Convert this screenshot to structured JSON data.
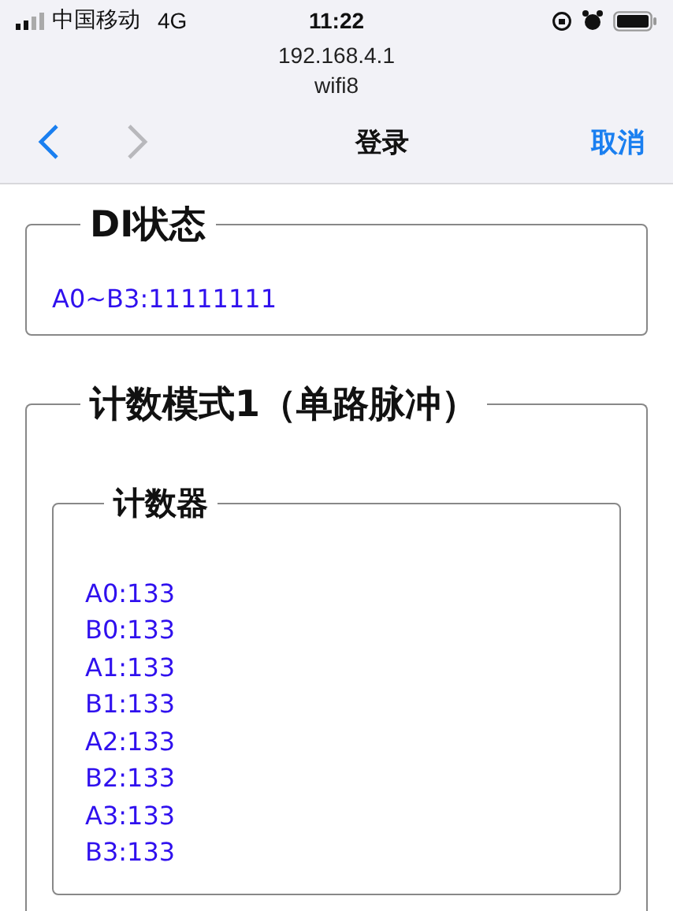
{
  "status_bar": {
    "carrier": "中国移动",
    "network": "4G",
    "time": "11:22"
  },
  "address": {
    "host": "192.168.4.1",
    "ssid": "wifi8"
  },
  "nav": {
    "back": {
      "disabled": false
    },
    "forward": {
      "disabled": true
    },
    "title": "登录",
    "cancel": "取消"
  },
  "sections": [
    {
      "legend": "DI状态",
      "lines": [
        "A0~B3:11111111"
      ]
    },
    {
      "legend": "计数模式1（单路脉冲）",
      "groups": [
        {
          "legend": "计数器",
          "lines": [
            "A0:133",
            "B0:133",
            "A1:133",
            "B1:133",
            "A2:133",
            "B2:133",
            "A3:133",
            "B3:133"
          ]
        }
      ]
    }
  ]
}
